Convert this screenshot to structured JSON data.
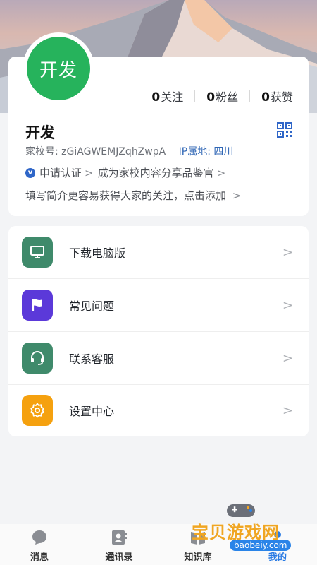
{
  "profile": {
    "avatar_text": "开发",
    "name": "开发",
    "stats": [
      {
        "count": "0",
        "label": "关注"
      },
      {
        "count": "0",
        "label": "粉丝"
      },
      {
        "count": "0",
        "label": "获赞"
      }
    ],
    "school_id_label": "家校号:",
    "school_id": "zGiAGWEMJZqhZwpA",
    "ip_label": "IP属地:",
    "ip_value": "四川",
    "verify_badge": "v",
    "verify_label": "申请认证",
    "verify_chevron": ">",
    "curator_label": "成为家校内容分享品鉴官",
    "curator_chevron": ">",
    "intro_text": "填写简介更容易获得大家的关注，点击添加",
    "intro_chevron": ">"
  },
  "menu": [
    {
      "label": "下载电脑版",
      "icon": "monitor-icon",
      "color": "#3f8a6b"
    },
    {
      "label": "常见问题",
      "icon": "flag-icon",
      "color": "#5b39d9"
    },
    {
      "label": "联系客服",
      "icon": "headset-icon",
      "color": "#3f8a6b"
    },
    {
      "label": "设置中心",
      "icon": "gear-icon",
      "color": "#f5a10f"
    }
  ],
  "menu_arrow": ">",
  "tabs": [
    {
      "label": "消息",
      "icon": "chat-icon"
    },
    {
      "label": "通讯录",
      "icon": "contacts-icon"
    },
    {
      "label": "知识库",
      "icon": "book-icon"
    },
    {
      "label": "我的",
      "icon": "user-icon",
      "active": true
    }
  ],
  "watermark": {
    "text": "宝贝游戏网",
    "url": "baobeiy.com"
  },
  "colors": {
    "accent": "#2a7be4",
    "avatar": "#26b35c",
    "ip": "#2f66b5"
  }
}
